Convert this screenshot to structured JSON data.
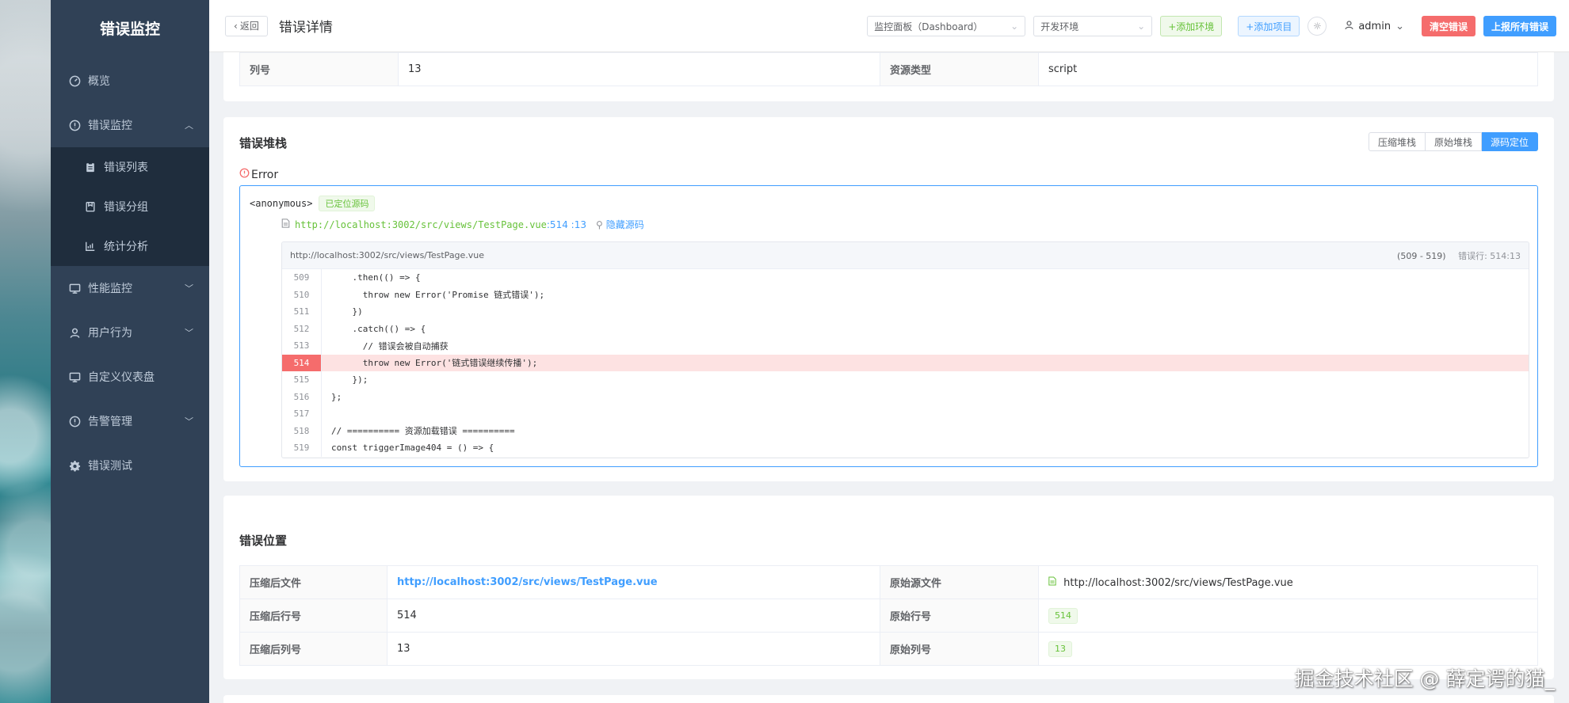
{
  "sidebar": {
    "logo": "错误监控",
    "items": [
      {
        "label": "概览",
        "icon": "dashboard-icon"
      },
      {
        "label": "错误监控",
        "icon": "warning-circle-icon",
        "expanded": true
      },
      {
        "label": "错误列表",
        "icon": "clipboard-icon"
      },
      {
        "label": "错误分组",
        "icon": "folder-icon"
      },
      {
        "label": "统计分析",
        "icon": "chart-icon"
      },
      {
        "label": "性能监控",
        "icon": "monitor-icon"
      },
      {
        "label": "用户行为",
        "icon": "user-icon"
      },
      {
        "label": "自定义仪表盘",
        "icon": "monitor-icon"
      },
      {
        "label": "告警管理",
        "icon": "warning-circle-icon"
      },
      {
        "label": "错误测试",
        "icon": "gear-icon"
      }
    ]
  },
  "header": {
    "back_label": "返回",
    "title": "错误详情",
    "dashboard_select": "监控面板（Dashboard）",
    "env_select": "开发环境",
    "add_env": "+添加环境",
    "add_project": "+添加项目",
    "user": "admin",
    "clear_errors": "清空错误",
    "report_all": "上报所有错误"
  },
  "info_row": {
    "col_label": "列号",
    "col_value": "13",
    "res_label": "资源类型",
    "res_value": "script"
  },
  "stack": {
    "title": "错误堆栈",
    "tabs": [
      "压缩堆栈",
      "原始堆栈",
      "源码定位"
    ],
    "active_tab": "源码定位",
    "error_name": "Error",
    "frame_fn": "<anonymous>",
    "located_tag": "已定位源码",
    "frame_url": "http://localhost:3002/src/views/TestPage.vue",
    "frame_pos": ":514 :13",
    "hide_source": "隐藏源码",
    "code_file": "http://localhost:3002/src/views/TestPage.vue",
    "code_range": "(509 - 519)",
    "code_err_line": "错误行: 514:13",
    "lines": [
      {
        "n": "509",
        "code": "    .then(() => {",
        "hl": false
      },
      {
        "n": "510",
        "code": "      throw new Error('Promise 链式错误');",
        "hl": false
      },
      {
        "n": "511",
        "code": "    })",
        "hl": false
      },
      {
        "n": "512",
        "code": "    .catch(() => {",
        "hl": false
      },
      {
        "n": "513",
        "code": "      // 错误会被自动捕获",
        "hl": false
      },
      {
        "n": "514",
        "code": "      throw new Error('链式错误继续传播');",
        "hl": true
      },
      {
        "n": "515",
        "code": "    });",
        "hl": false
      },
      {
        "n": "516",
        "code": "};",
        "hl": false
      },
      {
        "n": "517",
        "code": "",
        "hl": false
      },
      {
        "n": "518",
        "code": "// ========== 资源加载错误 ==========",
        "hl": false
      },
      {
        "n": "519",
        "code": "const triggerImage404 = () => {",
        "hl": false
      }
    ]
  },
  "location": {
    "title": "错误位置",
    "min_file_label": "压缩后文件",
    "min_file_value": "http://localhost:3002/src/views/TestPage.vue",
    "orig_file_label": "原始源文件",
    "orig_file_value": "http://localhost:3002/src/views/TestPage.vue",
    "min_line_label": "压缩后行号",
    "min_line_value": "514",
    "orig_line_label": "原始行号",
    "orig_line_value": "514",
    "min_col_label": "压缩后列号",
    "min_col_value": "13",
    "orig_col_label": "原始列号",
    "orig_col_value": "13"
  },
  "watermark": "掘金技术社区 @ 薛定谔的猫_",
  "colors": {
    "primary": "#409eff",
    "danger": "#f56c6c",
    "success": "#67c23a",
    "sidebar": "#304156"
  }
}
